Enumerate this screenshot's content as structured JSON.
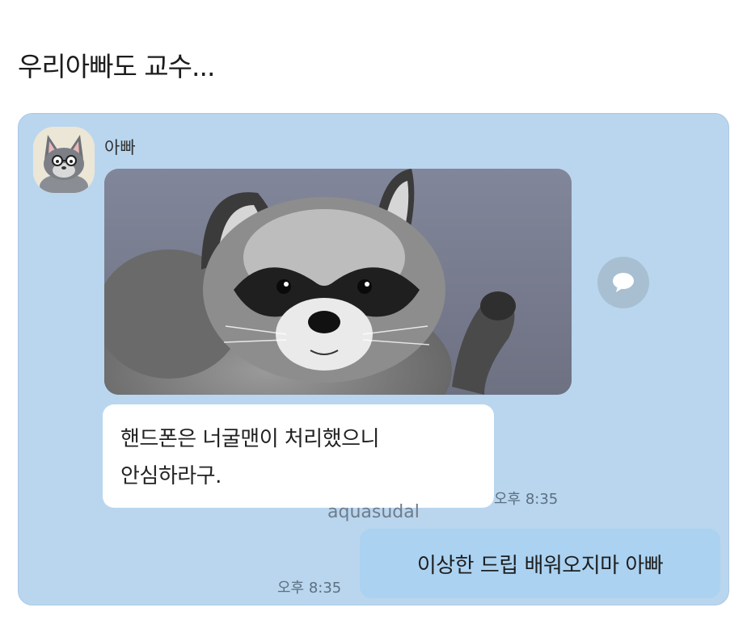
{
  "post": {
    "title": "우리아빠도 교수..."
  },
  "chat": {
    "sender_name": "아빠",
    "incoming_message": {
      "line1": "핸드폰은 너굴맨이 처리했으니",
      "line2": "안심하라구.",
      "time": "오후 8:35"
    },
    "outgoing_message": {
      "text": "이상한 드립 배워오지마 아빠",
      "time": "오후 8:35"
    },
    "watermark": "aquasudal",
    "photo_subject": "raccoon-waving",
    "colors": {
      "chat_background": "#b9d6ee",
      "incoming_bubble": "#ffffff",
      "outgoing_bubble": "#abd2f1"
    }
  }
}
